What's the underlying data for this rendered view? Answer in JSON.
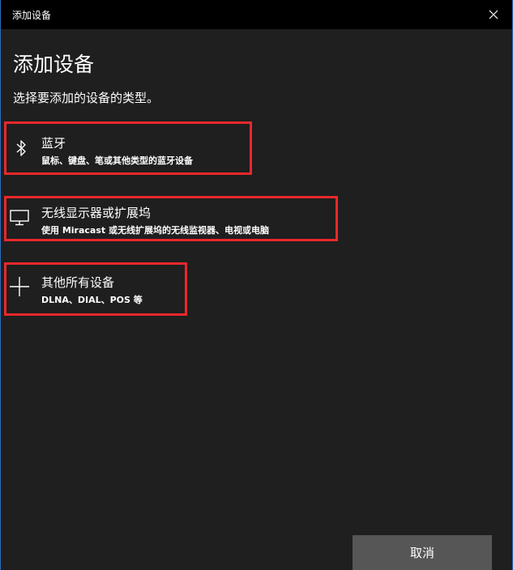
{
  "window": {
    "title": "添加设备"
  },
  "main": {
    "title": "添加设备",
    "subtitle": "选择要添加的设备的类型。",
    "options": [
      {
        "title": "蓝牙",
        "desc": "鼠标、键盘、笔或其他类型的蓝牙设备",
        "icon": "bluetooth-icon"
      },
      {
        "title": "无线显示器或扩展坞",
        "desc": "使用 Miracast 或无线扩展坞的无线监视器、电视或电脑",
        "icon": "monitor-icon"
      },
      {
        "title": "其他所有设备",
        "desc": "DLNA、DIAL、POS 等",
        "icon": "plus-icon"
      }
    ]
  },
  "footer": {
    "cancel_label": "取消"
  },
  "colors": {
    "highlight": "#e8282b",
    "background": "#1f1f1f",
    "titlebar": "#000000",
    "button": "#565656"
  }
}
